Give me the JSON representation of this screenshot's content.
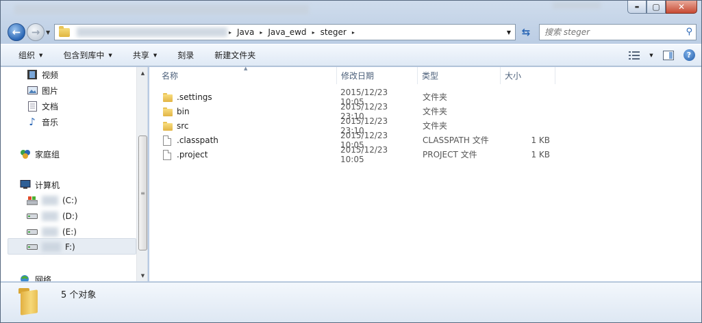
{
  "window": {
    "controls": {
      "minimize": "▬",
      "maximize": "▢",
      "close": "✕"
    }
  },
  "address": {
    "breadcrumb": [
      "Java",
      "Java_ewd",
      "steger"
    ],
    "separator": "▸",
    "dropdown": "▼"
  },
  "search": {
    "placeholder": "搜索 steger",
    "icon": "search-icon"
  },
  "commands": [
    {
      "label": "组织",
      "dropdown": true
    },
    {
      "label": "包含到库中",
      "dropdown": true
    },
    {
      "label": "共享",
      "dropdown": true
    },
    {
      "label": "刻录",
      "dropdown": false
    },
    {
      "label": "新建文件夹",
      "dropdown": false
    }
  ],
  "nav": {
    "libraries": [
      {
        "label": "视频",
        "icon": "video-icon"
      },
      {
        "label": "图片",
        "icon": "pictures-icon"
      },
      {
        "label": "文档",
        "icon": "documents-icon"
      },
      {
        "label": "音乐",
        "icon": "music-icon"
      }
    ],
    "homegroup": {
      "label": "家庭组",
      "icon": "homegroup-icon"
    },
    "computer": {
      "label": "计算机",
      "icon": "computer-icon"
    },
    "drives": [
      {
        "label": "(C:)",
        "icon": "system-drive-icon"
      },
      {
        "label": "(D:)",
        "icon": "drive-icon"
      },
      {
        "label": "(E:)",
        "icon": "drive-icon"
      },
      {
        "label": "F:)",
        "icon": "drive-icon",
        "selected": true
      }
    ],
    "network": {
      "label": "网络",
      "icon": "network-icon"
    }
  },
  "columns": {
    "name": "名称",
    "date": "修改日期",
    "type": "类型",
    "size": "大小"
  },
  "files": [
    {
      "name": ".settings",
      "date": "2015/12/23 10:05",
      "type": "文件夹",
      "size": "",
      "kind": "folder"
    },
    {
      "name": "bin",
      "date": "2015/12/23 23:10",
      "type": "文件夹",
      "size": "",
      "kind": "folder"
    },
    {
      "name": "src",
      "date": "2015/12/23 23:10",
      "type": "文件夹",
      "size": "",
      "kind": "folder"
    },
    {
      "name": ".classpath",
      "date": "2015/12/23 10:05",
      "type": "CLASSPATH 文件",
      "size": "1 KB",
      "kind": "file"
    },
    {
      "name": ".project",
      "date": "2015/12/23 10:05",
      "type": "PROJECT 文件",
      "size": "1 KB",
      "kind": "file"
    }
  ],
  "status": {
    "count_text": "5 个对象"
  },
  "colors": {
    "accent": "#2a66b5",
    "folder": "#f2cc62",
    "selection": "#e6ecf3"
  }
}
